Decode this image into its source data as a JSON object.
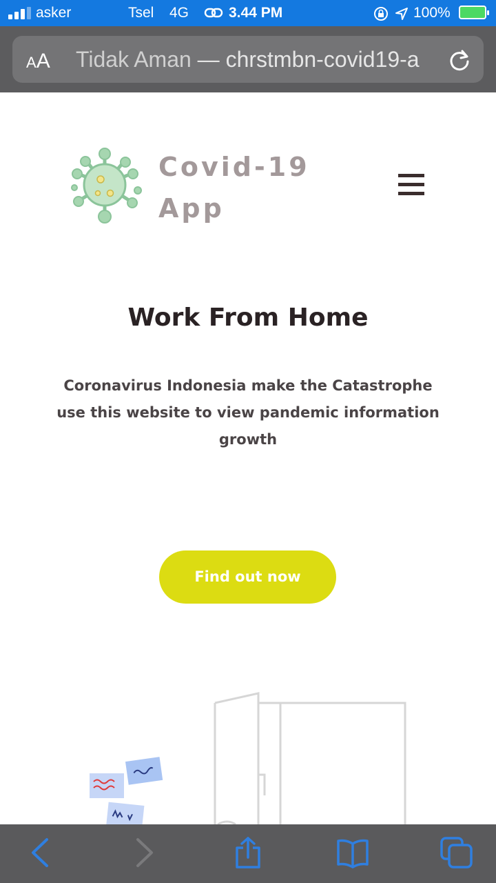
{
  "status_bar": {
    "carrier_left": "asker",
    "carrier": "Tsel",
    "network": "4G",
    "time": "3.44 PM",
    "battery": "100%"
  },
  "address_bar": {
    "text_size_small": "A",
    "text_size_large": "A",
    "security": "Tidak Aman",
    "separator": " — ",
    "url": "chrstmbn-covid19-a"
  },
  "header": {
    "brand_line1": "Covid-19",
    "brand_line2": "App"
  },
  "hero": {
    "title": "Work From Home",
    "subtitle": "Coronavirus Indonesia make the Catastrophe use this website to view pandemic information growth",
    "cta_label": "Find out now"
  },
  "colors": {
    "status_bar": "#1479e0",
    "cta": "#dcdc12",
    "brand_text": "#a3999a",
    "toolbar_icon": "#2f7fe0"
  },
  "toolbar": {
    "icons": [
      "back-icon",
      "forward-icon",
      "share-icon",
      "bookmarks-icon",
      "tabs-icon"
    ]
  }
}
